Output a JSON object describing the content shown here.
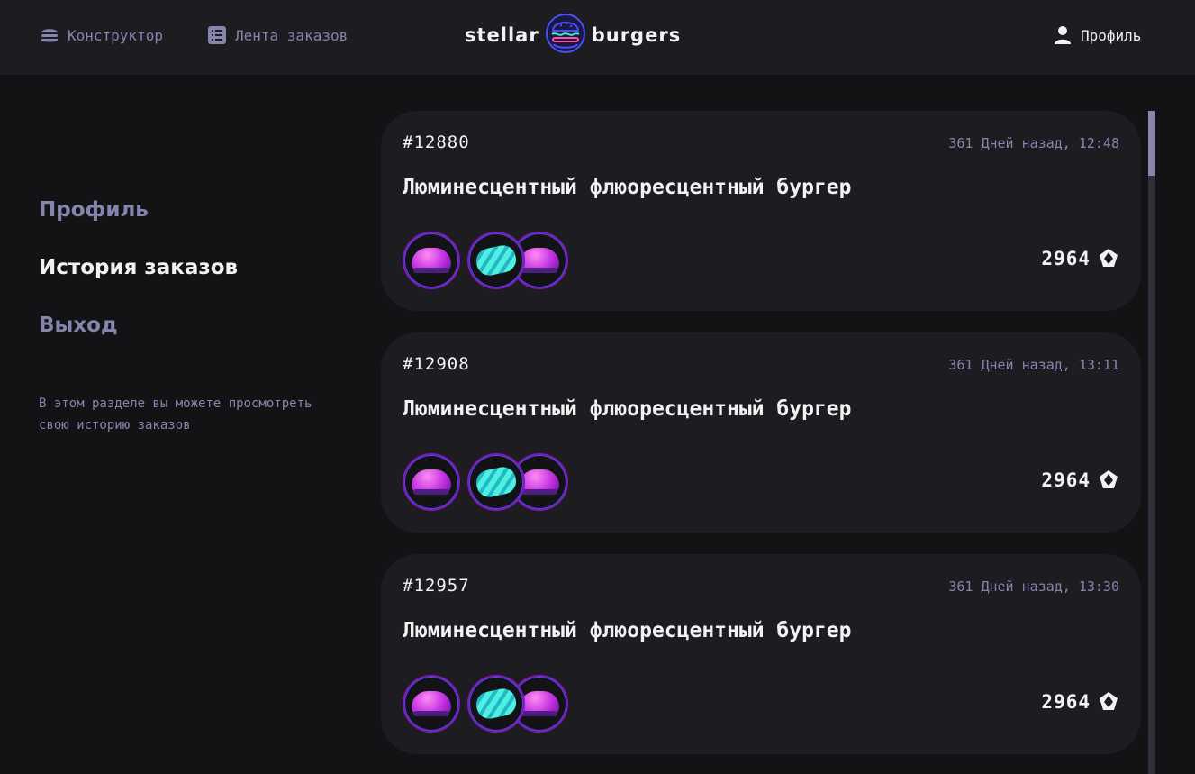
{
  "header": {
    "nav_constructor": "Конструктор",
    "nav_feed": "Лента заказов",
    "logo_left": "stellar",
    "logo_right": "burgers",
    "nav_profile": "Профиль"
  },
  "sidebar": {
    "items": [
      {
        "label": "Профиль",
        "active": false
      },
      {
        "label": "История заказов",
        "active": true
      },
      {
        "label": "Выход",
        "active": false
      }
    ],
    "note": "В этом разделе вы можете просмотреть свою историю заказов"
  },
  "orders": [
    {
      "number": "#12880",
      "date": "361 Дней назад, 12:48",
      "name": "Люминесцентный флюоресцентный бургер",
      "price": "2964"
    },
    {
      "number": "#12908",
      "date": "361 Дней назад, 13:11",
      "name": "Люминесцентный флюоресцентный бургер",
      "price": "2964"
    },
    {
      "number": "#12957",
      "date": "361 Дней назад, 13:30",
      "name": "Люминесцентный флюоресцентный бургер",
      "price": "2964"
    }
  ],
  "icons": {
    "burger": "burger-icon",
    "list": "list-icon",
    "profile": "profile-icon",
    "currency": "currency-icon"
  },
  "colors": {
    "background": "#131316",
    "card": "#1C1C21",
    "inactive_text": "#8585AD",
    "accent": "#801AB2"
  }
}
